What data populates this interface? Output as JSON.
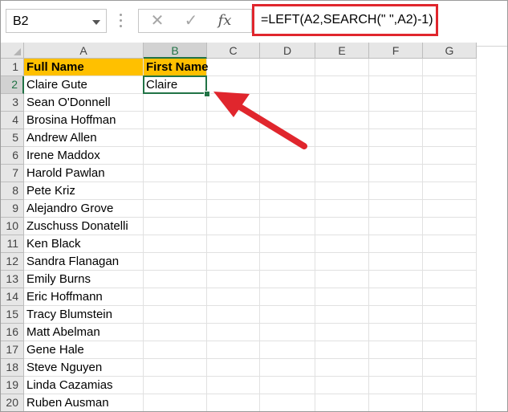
{
  "name_box": {
    "value": "B2"
  },
  "formula_bar": {
    "cancel_icon": "x-icon",
    "enter_icon": "check-icon",
    "function_label": "fx",
    "formula": "=LEFT(A2,SEARCH(\" \",A2)-1)"
  },
  "columns": [
    "A",
    "B",
    "C",
    "D",
    "E",
    "F",
    "G"
  ],
  "rows": [
    "1",
    "2",
    "3",
    "4",
    "5",
    "6",
    "7",
    "8",
    "9",
    "10",
    "11",
    "12",
    "13",
    "14",
    "15",
    "16",
    "17",
    "18",
    "19",
    "20"
  ],
  "headers": {
    "full_name": "Full Name",
    "first_name": "First Name"
  },
  "full_names": [
    "Claire Gute",
    "Sean O'Donnell",
    "Brosina Hoffman",
    "Andrew Allen",
    "Irene Maddox",
    "Harold Pawlan",
    "Pete Kriz",
    "Alejandro Grove",
    "Zuschuss Donatelli",
    "Ken Black",
    "Sandra Flanagan",
    "Emily Burns",
    "Eric Hoffmann",
    "Tracy Blumstein",
    "Matt Abelman",
    "Gene Hale",
    "Steve Nguyen",
    "Linda Cazamias",
    "Ruben Ausman"
  ],
  "first_names": [
    "Claire"
  ],
  "colors": {
    "header_fill": "#ffc000",
    "selection": "#217346",
    "annotation": "#e0262d"
  }
}
